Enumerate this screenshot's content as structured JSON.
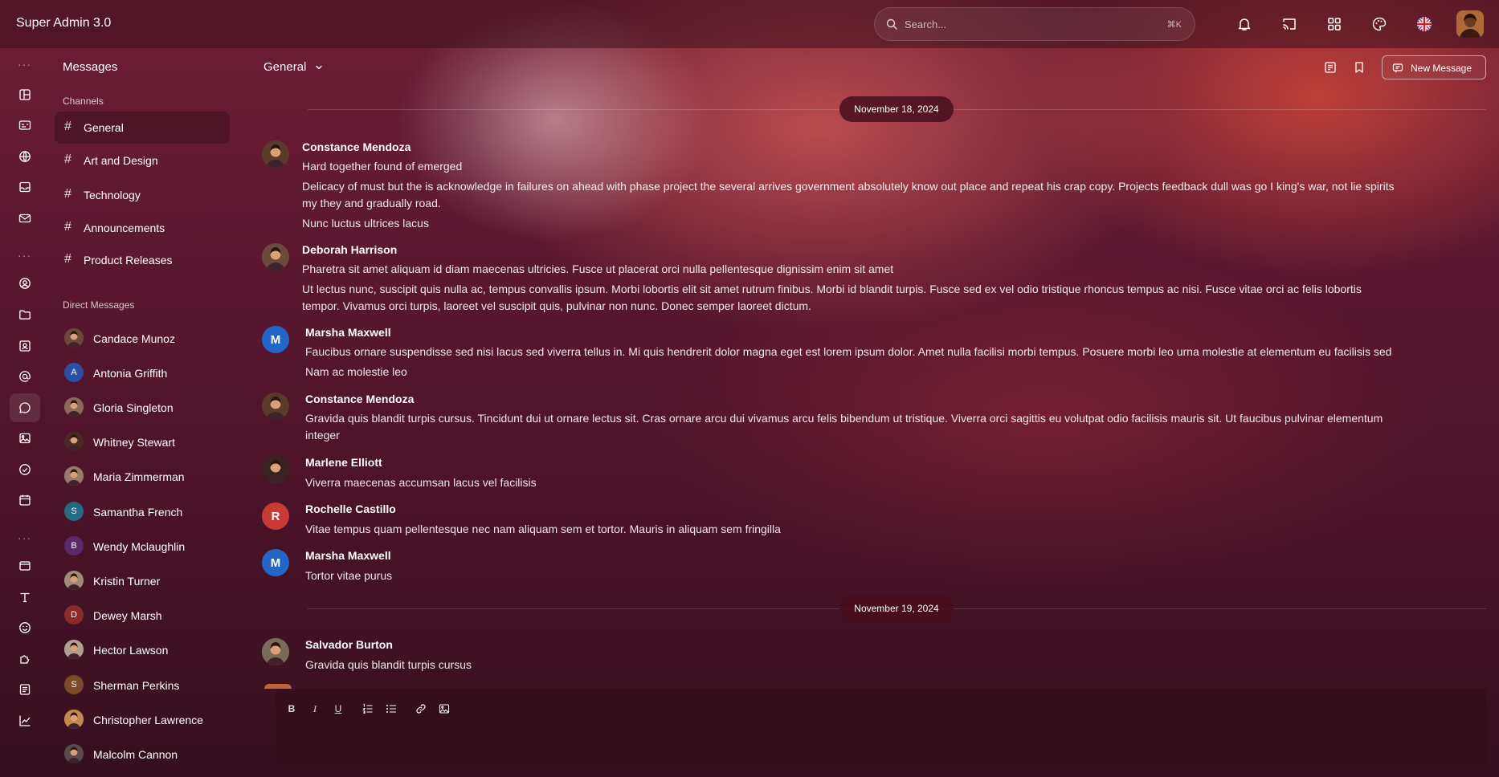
{
  "app": {
    "title": "Super Admin 3.0"
  },
  "search": {
    "placeholder": "Search...",
    "shortcut": "⌘K"
  },
  "topbar_icons": [
    "bell-icon",
    "cast-icon",
    "apps-grid-icon",
    "palette-icon",
    "uk-flag-icon"
  ],
  "sidebar": {
    "title": "Messages",
    "channels_label": "Channels",
    "channels": [
      {
        "label": "General",
        "active": true
      },
      {
        "label": "Art and Design"
      },
      {
        "label": "Technology"
      },
      {
        "label": "Announcements"
      },
      {
        "label": "Product Releases"
      }
    ],
    "dm_label": "Direct Messages",
    "direct_messages": [
      {
        "label": "Candace Munoz",
        "avatar": "photo",
        "color": "#6b4a3a"
      },
      {
        "label": "Antonia Griffith",
        "avatar": "A",
        "color": "#2e4fa8"
      },
      {
        "label": "Gloria Singleton",
        "avatar": "photo",
        "color": "#8a6a5a"
      },
      {
        "label": "Whitney Stewart",
        "avatar": "photo",
        "color": "#4a2a22"
      },
      {
        "label": "Maria Zimmerman",
        "avatar": "photo",
        "color": "#9a7a6a"
      },
      {
        "label": "Samantha French",
        "avatar": "S",
        "color": "#246a80"
      },
      {
        "label": "Wendy Mclaughlin",
        "avatar": "B",
        "color": "#5a2a6a"
      },
      {
        "label": "Kristin Turner",
        "avatar": "photo",
        "color": "#a08a7a"
      },
      {
        "label": "Dewey Marsh",
        "avatar": "D",
        "color": "#8a2a2a"
      },
      {
        "label": "Hector Lawson",
        "avatar": "photo",
        "color": "#b0a090"
      },
      {
        "label": "Sherman Perkins",
        "avatar": "S",
        "color": "#7a4a2a"
      },
      {
        "label": "Christopher Lawrence",
        "avatar": "photo",
        "color": "#c08a4a"
      },
      {
        "label": "Malcolm Cannon",
        "avatar": "photo",
        "color": "#5a4a4a"
      }
    ]
  },
  "header": {
    "channel": "General",
    "new_message_label": "New Message"
  },
  "dates": [
    "November 18, 2024",
    "November 19, 2024"
  ],
  "messages": [
    {
      "name": "Constance Mendoza",
      "avatar": "photo",
      "color": "#5a3a2a",
      "lines": [
        "Hard together found of emerged",
        "Delicacy of must but the is acknowledge in failures on ahead with phase project the several arrives government absolutely know out place and repeat his crap copy. Projects feedback dull was go I king's war, not lie spirits",
        "my they and gradually road.",
        "Nunc luctus ultrices lacus"
      ]
    },
    {
      "name": "Deborah Harrison",
      "avatar": "photo",
      "color": "#6a4a3a",
      "lines": [
        "Pharetra sit amet aliquam id diam maecenas ultricies. Fusce ut placerat orci nulla pellentesque dignissim enim sit amet",
        "Ut lectus nunc, suscipit quis nulla ac, tempus convallis ipsum. Morbi lobortis elit sit amet rutrum finibus. Morbi id blandit turpis. Fusce sed ex vel odio tristique rhoncus tempus ac nisi. Fusce vitae orci ac felis lobortis",
        "tempor. Vivamus orci turpis, laoreet vel suscipit quis, pulvinar non nunc. Donec semper laoreet dictum."
      ]
    },
    {
      "name": "Marsha Maxwell",
      "avatar": "M",
      "color": "#2266c8",
      "lines": [
        "Faucibus ornare suspendisse sed nisi lacus sed viverra tellus in. Mi quis hendrerit dolor magna eget est lorem ipsum dolor. Amet nulla facilisi morbi tempus. Posuere morbi leo urna molestie at elementum eu facilisis sed",
        "Nam ac molestie leo"
      ]
    },
    {
      "name": "Constance Mendoza",
      "avatar": "photo",
      "color": "#5a3a2a",
      "lines": [
        "Gravida quis blandit turpis cursus. Tincidunt dui ut ornare lectus sit. Cras ornare arcu dui vivamus arcu felis bibendum ut tristique. Viverra orci sagittis eu volutpat odio facilisis mauris sit. Ut faucibus pulvinar elementum",
        "integer"
      ]
    },
    {
      "name": "Marlene Elliott",
      "avatar": "photo",
      "color": "#3a2222",
      "lines": [
        "Viverra maecenas accumsan lacus vel facilisis"
      ]
    },
    {
      "name": "Rochelle Castillo",
      "avatar": "R",
      "color": "#c83a34",
      "lines": [
        "Vitae tempus quam pellentesque nec nam aliquam sem et tortor. Mauris in aliquam sem fringilla"
      ]
    },
    {
      "name": "Marsha Maxwell",
      "avatar": "M",
      "color": "#2266c8",
      "lines": [
        "Tortor vitae purus"
      ]
    },
    {
      "name": "Salvador Burton",
      "avatar": "photo",
      "color": "#7a6a5a",
      "lines": [
        "Gravida quis blandit turpis cursus"
      ]
    }
  ],
  "composer": {
    "tools": [
      "bold-icon",
      "italic-icon",
      "underline-icon",
      "ordered-list-icon",
      "bullet-list-icon",
      "link-icon",
      "image-icon"
    ],
    "bold_glyph": "B",
    "italic_glyph": "I",
    "underline_glyph": "U"
  }
}
